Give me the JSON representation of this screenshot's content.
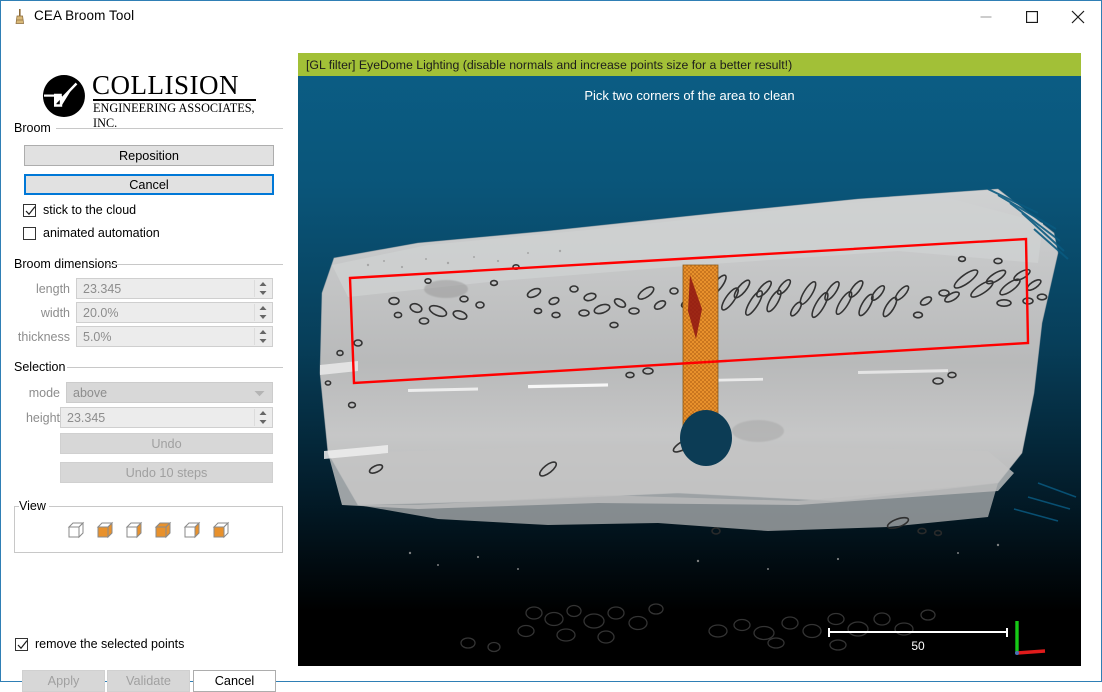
{
  "window": {
    "title": "CEA Broom Tool",
    "icon": "broom-icon",
    "minimize_label": "Minimize",
    "maximize_label": "Maximize",
    "close_label": "Close",
    "border_color": "#2f7fb5"
  },
  "logo": {
    "line1": "COLLISION",
    "line2": "ENGINEERING ASSOCIATES, INC."
  },
  "broom_group": {
    "title": "Broom",
    "reposition_label": "Reposition",
    "cancel_label": "Cancel",
    "stick_to_cloud": {
      "label": "stick to the cloud",
      "checked": "true"
    },
    "animated_automation": {
      "label": "animated automation",
      "checked": "false"
    }
  },
  "dimensions_group": {
    "title": "Broom dimensions",
    "fields": [
      {
        "label": "length",
        "value": "23.345"
      },
      {
        "label": "width",
        "value": "20.0%"
      },
      {
        "label": "thickness",
        "value": "5.0%"
      }
    ]
  },
  "selection_group": {
    "title": "Selection",
    "mode_label": "mode",
    "mode_value": "above",
    "mode_options": [
      "above"
    ],
    "height_label": "height",
    "height_value": "23.345",
    "undo_label": "Undo",
    "undo10_label": "Undo 10 steps"
  },
  "view_group": {
    "title": "View",
    "buttons": [
      {
        "name": "view-cube-front",
        "highlight": "none"
      },
      {
        "name": "view-cube-left",
        "highlight": "left-front"
      },
      {
        "name": "view-cube-right",
        "highlight": "front-right"
      },
      {
        "name": "view-cube-top",
        "highlight": "top-front"
      },
      {
        "name": "view-cube-back",
        "highlight": "right"
      },
      {
        "name": "view-cube-bottom",
        "highlight": "bottom-front"
      }
    ]
  },
  "footer": {
    "remove_points": {
      "label": "remove the selected points",
      "checked": "true"
    },
    "apply_label": "Apply",
    "validate_label": "Validate",
    "cancel_label": "Cancel"
  },
  "viewport": {
    "gl_banner": "[GL filter] EyeDome Lighting (disable normals and increase points size for a better result!)",
    "gl_banner_color": "#a2c037",
    "message": "Pick two corners of the area to clean",
    "scale_value": "50",
    "selection_color": "#ff0000",
    "broom_color": "#e8912c",
    "background_top": "#0b5e86",
    "background_bottom": "#000000",
    "axis_x_color": "#e01b1b",
    "axis_y_color": "#16c916"
  }
}
